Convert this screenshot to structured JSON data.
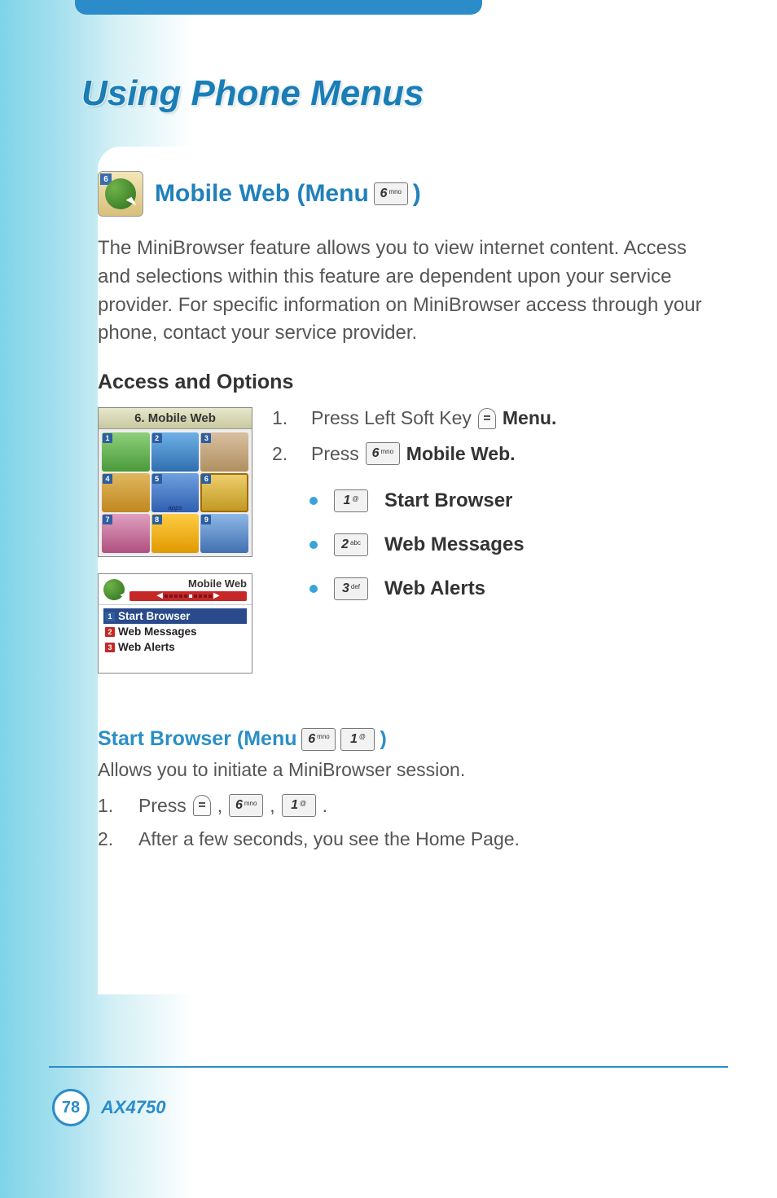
{
  "page": {
    "title": "Using Phone Menus",
    "number": "78",
    "model": "AX4750"
  },
  "section": {
    "title_pre": "Mobile Web (Menu ",
    "title_post": ")",
    "icon_corner": "6",
    "key6_big": "6",
    "key6_sup": "mno",
    "intro": "The MiniBrowser feature allows you to view internet content. Access and selections within this feature are dependent upon your service provider. For specific information on MiniBrowser access through your phone, contact your service provider."
  },
  "access": {
    "heading": "Access and Options",
    "screen1_title": "6. Mobile Web",
    "screen1_cells": [
      "1",
      "2",
      "3",
      "4",
      "5",
      "6",
      "7",
      "8",
      "9"
    ],
    "screen1_apps": "apps",
    "screen2_title": "Mobile Web",
    "screen2_items": [
      {
        "n": "1",
        "label": "Start Browser"
      },
      {
        "n": "2",
        "label": "Web Messages"
      },
      {
        "n": "3",
        "label": "Web Alerts"
      }
    ],
    "steps": [
      {
        "n": "1.",
        "pre": "Press Left Soft Key ",
        "bold": "Menu",
        "post": "."
      },
      {
        "n": "2.",
        "pre": "Press ",
        "bold": "Mobile Web",
        "post": "."
      }
    ],
    "bullets": [
      {
        "key_big": "1",
        "key_sup": "@",
        "label": "Start Browser"
      },
      {
        "key_big": "2",
        "key_sup": "abc",
        "label": "Web Messages"
      },
      {
        "key_big": "3",
        "key_sup": "def",
        "label": "Web Alerts"
      }
    ]
  },
  "start_browser": {
    "title_pre": "Start Browser (Menu ",
    "title_post": ")",
    "key1_big": "1",
    "key1_sup": "@",
    "desc": "Allows you to initiate a MiniBrowser session.",
    "steps": [
      {
        "n": "1.",
        "text_pre": "Press ",
        "text_mid": ", ",
        "text_end": "."
      },
      {
        "n": "2.",
        "text": "After a few seconds, you see the Home Page."
      }
    ]
  }
}
